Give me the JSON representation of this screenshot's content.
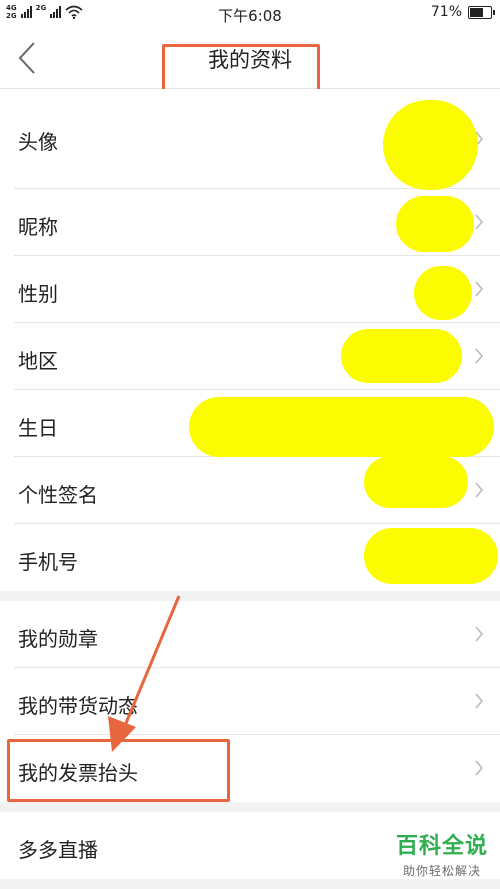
{
  "status_bar": {
    "network_top": "4G",
    "network_bottom": "2G",
    "network2": "2G",
    "time": "下午6:08",
    "battery_text": "71%",
    "battery_level_percent": 71
  },
  "nav": {
    "title": "我的资料"
  },
  "profile_rows": [
    {
      "label": "头像"
    },
    {
      "label": "昵称"
    },
    {
      "label": "性别"
    },
    {
      "label": "地区"
    },
    {
      "label": "生日"
    },
    {
      "label": "个性签名"
    },
    {
      "label": "手机号"
    }
  ],
  "more_rows": [
    {
      "label": "我的勋章"
    },
    {
      "label": "我的带货动态"
    },
    {
      "label": "我的发票抬头"
    }
  ],
  "last_row": {
    "label": "多多直播"
  },
  "watermark": {
    "title": "百科全说",
    "subtitle": "助你轻松解决"
  },
  "colors": {
    "highlight": "#e8663d",
    "redaction": "#fcfc00",
    "watermark": "#2fae4f"
  }
}
